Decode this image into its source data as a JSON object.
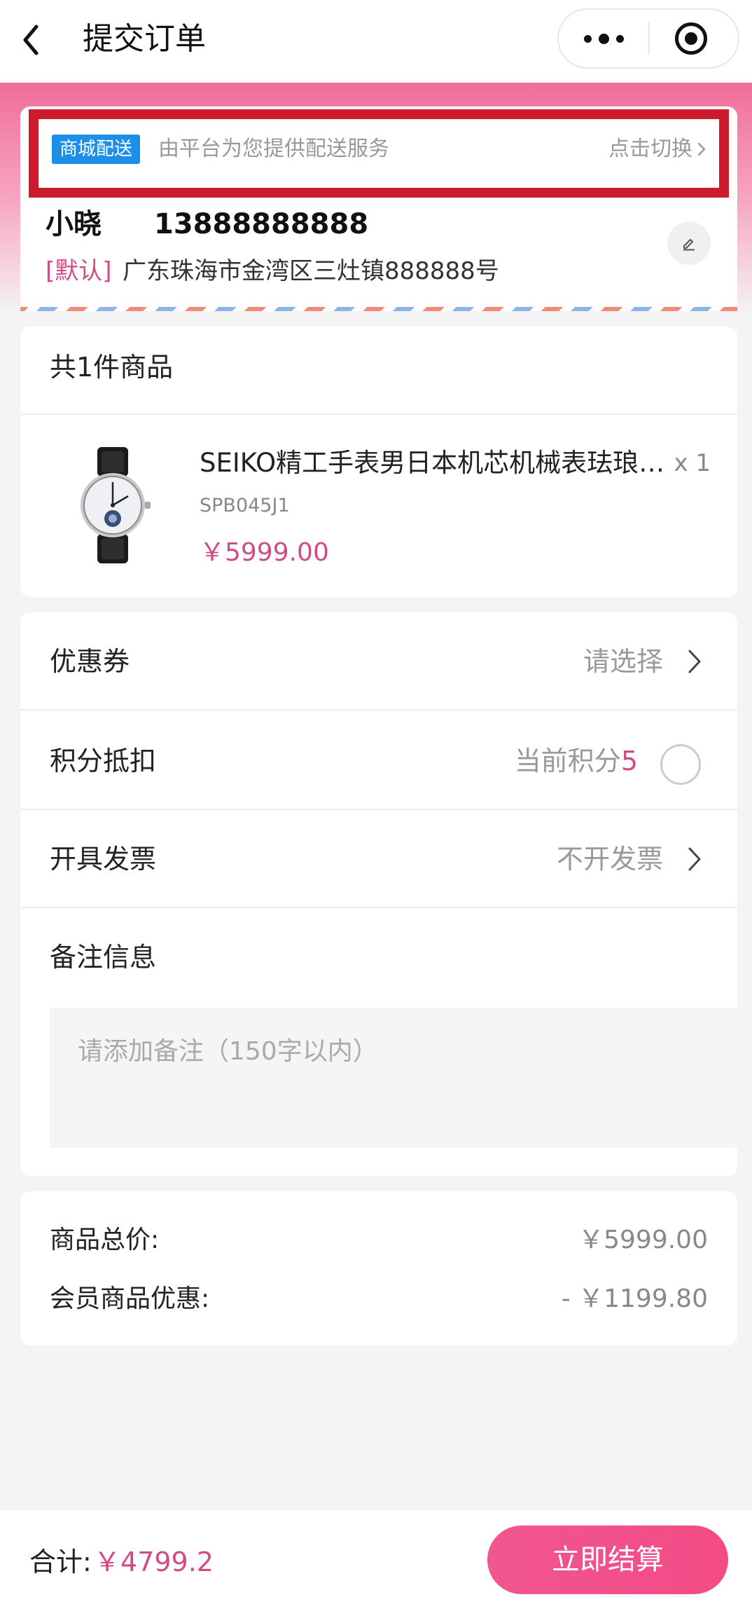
{
  "nav": {
    "title": "提交订单",
    "back_icon": "chevron-left-icon",
    "more_icon": "more-dots-icon",
    "close_icon": "target-circle-icon"
  },
  "delivery": {
    "tag": "商城配送",
    "description": "由平台为您提供配送服务",
    "switch_label": "点击切换"
  },
  "address": {
    "name": "小晓",
    "phone": "13888888888",
    "default_tag": "[默认]",
    "detail": "广东珠海市金湾区三灶镇888888号"
  },
  "goods": {
    "header": "共1件商品",
    "items": [
      {
        "title": "SEIKO精工手表男日本机芯机械表珐琅表盘陀飞轮镂空",
        "sku": "SPB045J1",
        "price": "￥5999.00",
        "quantity": "x 1"
      }
    ]
  },
  "options": {
    "coupon": {
      "label": "优惠券",
      "value": "请选择"
    },
    "points": {
      "label": "积分抵扣",
      "value_prefix": "当前积分",
      "value_number": "5",
      "checked": false
    },
    "invoice": {
      "label": "开具发票",
      "value": "不开发票"
    },
    "remark": {
      "label": "备注信息",
      "placeholder": "请添加备注（150字以内）"
    }
  },
  "summary": {
    "rows": [
      {
        "label": "商品总价:",
        "value": "￥5999.00"
      },
      {
        "label": "会员商品优惠:",
        "value": "- ￥1199.80"
      }
    ]
  },
  "footer": {
    "total_label": "合计:",
    "total_value": "￥4799.2",
    "submit_label": "立即结算"
  },
  "colors": {
    "accent": "#d44a86",
    "brand_pink": "#f06e99",
    "delivery_tag": "#1e8fe8",
    "highlight_border": "#cc1b2c"
  }
}
